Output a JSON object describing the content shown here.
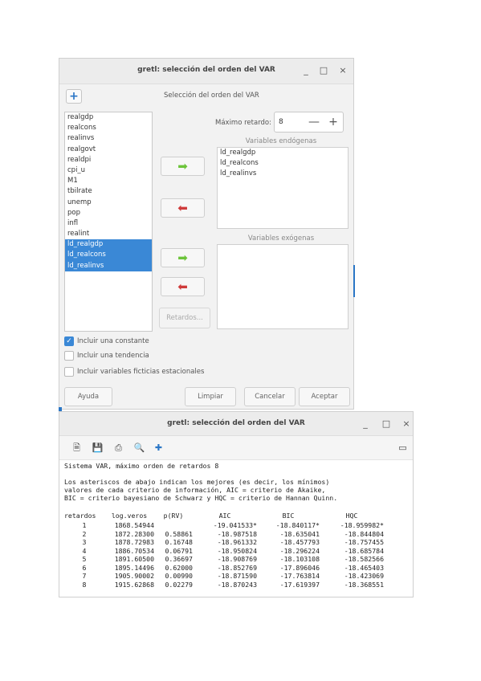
{
  "dialog": {
    "title": "gretl: selección del orden del VAR",
    "minimize": "_",
    "maximize": "□",
    "close": "×",
    "add_label": "+",
    "section_title": "Selección del orden del VAR",
    "variables": [
      {
        "name": "realgdp",
        "selected": false
      },
      {
        "name": "realcons",
        "selected": false
      },
      {
        "name": "realinvs",
        "selected": false
      },
      {
        "name": "realgovt",
        "selected": false
      },
      {
        "name": "realdpi",
        "selected": false
      },
      {
        "name": "cpi_u",
        "selected": false
      },
      {
        "name": "M1",
        "selected": false
      },
      {
        "name": "tbilrate",
        "selected": false
      },
      {
        "name": "unemp",
        "selected": false
      },
      {
        "name": "pop",
        "selected": false
      },
      {
        "name": "infl",
        "selected": false
      },
      {
        "name": "realint",
        "selected": false
      },
      {
        "name": "ld_realgdp",
        "selected": true
      },
      {
        "name": "ld_realcons",
        "selected": true
      },
      {
        "name": "ld_realinvs",
        "selected": true
      }
    ],
    "max_lag_label": "Máximo retardo:",
    "max_lag_value": "8",
    "minus": "—",
    "plus": "+",
    "endog_label": "Variables endógenas",
    "endog": [
      "ld_realgdp",
      "ld_realcons",
      "ld_realinvs"
    ],
    "exog_label": "Variables exógenas",
    "exog": [],
    "retardos_button": "Retardos...",
    "checkboxes": [
      {
        "label": "Incluir una constante",
        "checked": true
      },
      {
        "label": "Incluir una tendencia",
        "checked": false
      },
      {
        "label": "Incluir variables ficticias estacionales",
        "checked": false
      }
    ],
    "buttons": {
      "help": "Ayuda",
      "clear": "Limpiar",
      "cancel": "Cancelar",
      "ok": "Aceptar"
    },
    "colors": {
      "selection": "#3a88d6",
      "add_arrow": "#6cc43a",
      "remove_arrow": "#cf3b3b"
    }
  },
  "output_window": {
    "title": "gretl: selección del orden del VAR",
    "minimize": "_",
    "maximize": "□",
    "close": "×",
    "toolbar_icons": [
      "save-icon",
      "save-as-icon",
      "print-icon",
      "search-icon",
      "add-icon",
      "window-icon"
    ],
    "header_line": "Sistema VAR, máximo orden de retardos 8",
    "notes": [
      "Los asteriscos de abajo indican los mejores (es decir, los mínimos)",
      "valores de cada criterio de información, AIC = criterio de Akaike,",
      "BIC = criterio bayesiano de Schwarz y HQC = criterio de Hannan Quinn."
    ],
    "table": {
      "headers": [
        "retardos",
        "log.veros",
        "p(RV)",
        "AIC",
        "BIC",
        "HQC"
      ],
      "rows": [
        [
          "1",
          "1868.54944",
          "",
          "-19.041533*",
          "-18.840117*",
          "-18.959982*"
        ],
        [
          "2",
          "1872.28300",
          "0.58861",
          "-18.987518",
          "-18.635041",
          "-18.844804"
        ],
        [
          "3",
          "1878.72983",
          "0.16748",
          "-18.961332",
          "-18.457793",
          "-18.757455"
        ],
        [
          "4",
          "1886.70534",
          "0.06791",
          "-18.950824",
          "-18.296224",
          "-18.685784"
        ],
        [
          "5",
          "1891.60500",
          "0.36697",
          "-18.908769",
          "-18.103108",
          "-18.582566"
        ],
        [
          "6",
          "1895.14496",
          "0.62000",
          "-18.852769",
          "-17.896046",
          "-18.465403"
        ],
        [
          "7",
          "1905.90002",
          "0.00990",
          "-18.871590",
          "-17.763814",
          "-18.423069"
        ],
        [
          "8",
          "1915.62868",
          "0.02279",
          "-18.870243",
          "-17.619397",
          "-18.368551"
        ]
      ]
    }
  }
}
